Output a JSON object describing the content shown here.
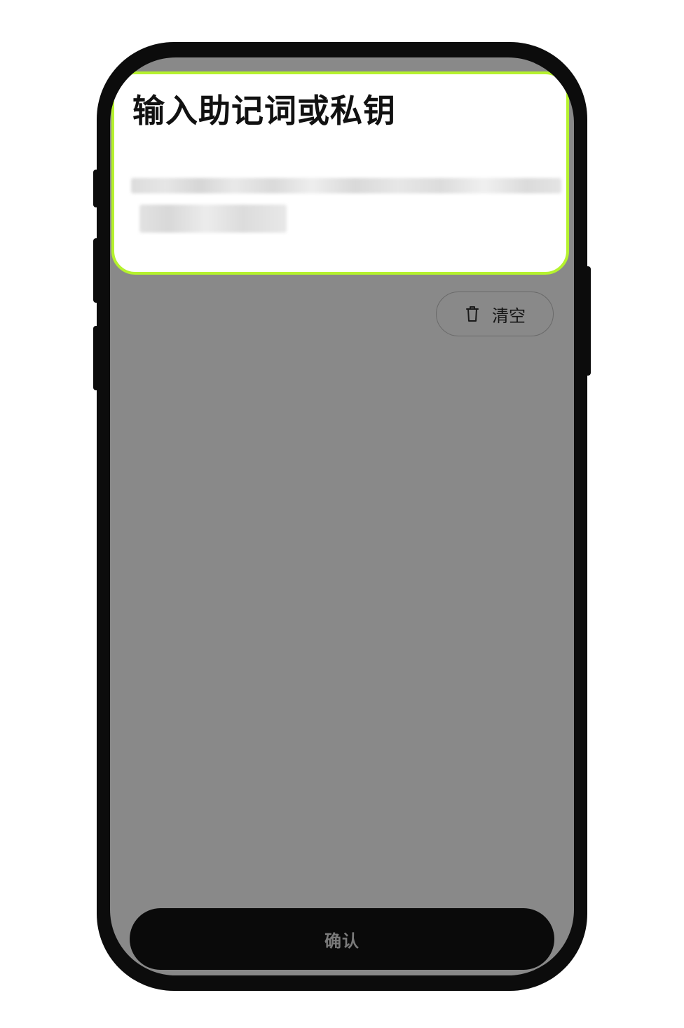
{
  "input_card": {
    "title": "输入助记词或私钥",
    "highlight_color": "#b5f22e"
  },
  "clear_button": {
    "icon": "trash-icon",
    "label": "清空"
  },
  "confirm_button": {
    "label": "确认"
  },
  "colors": {
    "screen_overlay": "#898989",
    "phone_frame": "#0c0c0c",
    "confirm_bg": "#0a0a0a"
  }
}
